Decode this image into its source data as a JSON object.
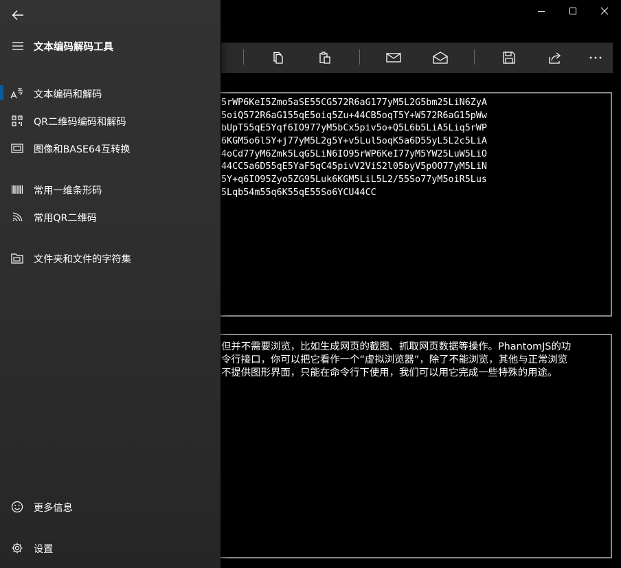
{
  "nav": {
    "title": "文本编码解码工具",
    "items": [
      {
        "label": "文本编码和解码",
        "icon": "font-encoding-icon",
        "selected": true
      },
      {
        "label": "QR二维码编码和解码",
        "icon": "qr-code-icon"
      },
      {
        "label": "图像和BASE64互转换",
        "icon": "image-icon"
      },
      {
        "label": "常用一维条形码",
        "icon": "barcode-icon"
      },
      {
        "label": "常用QR二维码",
        "icon": "wireless-signal-icon"
      },
      {
        "label": "文件夹和文件的字符集",
        "icon": "folder-icon"
      }
    ],
    "footer": [
      {
        "label": "更多信息",
        "icon": "smiley-icon"
      },
      {
        "label": "设置",
        "icon": "gear-icon"
      }
    ]
  },
  "toolbar": {
    "buttons": [
      "copy-icon",
      "paste-icon",
      "mail-icon",
      "mail-open-icon",
      "save-icon",
      "share-icon",
      "more-icon"
    ]
  },
  "encoded_text": {
    "lines": [
      "5rWP6KeI5Zmo5aSE55CG572R6aG177yM5L2G5bm25LiN6ZyA",
      "5oiQ572R6aG155qE5oiq5Zu+44CB5oqT5Y+W572R6aG15pWw",
      "bUpT55qE5Yqf6IO977yM5bCx5piv5o+Q5L6b5LiA5Liq5rWP",
      "6KGM5o6l5Y+j77yM5L2g5Y+v5Lul5oqK5a6D55yL5L2c5LiA",
      "4oCd77yM6Zmk5LqG5LiN6IO95rWP6KeI77yM5YW25LuW5LiO",
      "44CC5a6D55qE5YaF5qC45pivV2ViS2l05byV5pOO77yM5LiN",
      "5Y+q6IO95Zyo5ZG95Luk6KGM5LiL5L2/55So77yM5oiR5Lus",
      "5Lqb54m55q6K55qE55So6YCU44CC"
    ]
  },
  "decoded_text": {
    "lines": [
      "但并不需要浏览，比如生成网页的截图、抓取网页数据等操作。PhantomJS的功",
      "令行接口，你可以把它看作一个“虚拟浏览器”，除了不能浏览，其他与正常浏览",
      "不提供图形界面，只能在命令行下使用，我们可以用它完成一些特殊的用途。"
    ]
  },
  "colors": {
    "nav_background": "#2d2d2d",
    "selection_accent": "#0a5a9c",
    "textbox_border": "#8a8a8a",
    "command_bar": "#2b2b2b"
  }
}
